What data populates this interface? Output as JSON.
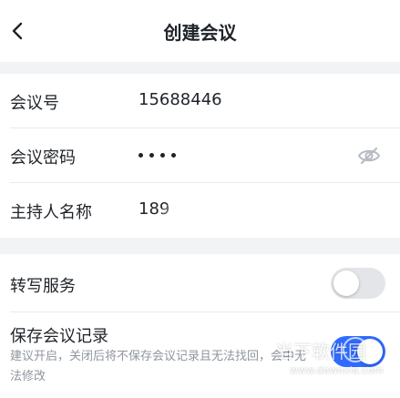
{
  "header": {
    "title": "创建会议",
    "back_icon": "chevron-left-icon"
  },
  "meeting": {
    "id_label": "会议号",
    "id_value": "15688446",
    "password_label": "会议密码",
    "password_mask_count": 4,
    "visibility_icon": "eye-off-icon",
    "host_label": "主持人名称",
    "host_value": "189"
  },
  "settings": {
    "transcription_label": "转写服务",
    "transcription_on": false,
    "save_record_label": "保存会议记录",
    "save_record_on": true,
    "save_record_desc": "建议开启，关闭后将不保存会议记录且无法找回，会中无法修改"
  },
  "watermark": {
    "text": "当下软件园",
    "url": "www.downxia.com"
  },
  "colors": {
    "accent": "#2f6bff",
    "toggle_off": "#e4e5e8",
    "background": "#f2f3f5"
  }
}
